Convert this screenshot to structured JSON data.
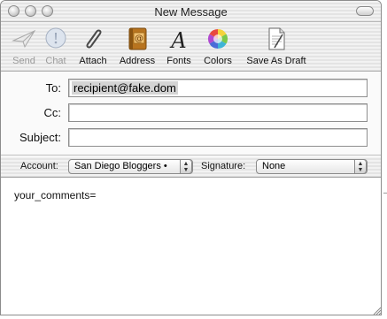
{
  "window": {
    "title": "New Message"
  },
  "toolbar": {
    "items": [
      {
        "label": "Send",
        "icon": "send-icon",
        "enabled": false
      },
      {
        "label": "Chat",
        "icon": "chat-icon",
        "enabled": false
      },
      {
        "label": "Attach",
        "icon": "paperclip-icon",
        "enabled": true
      },
      {
        "label": "Address",
        "icon": "address-book-icon",
        "enabled": true
      },
      {
        "label": "Fonts",
        "icon": "fonts-icon",
        "enabled": true
      },
      {
        "label": "Colors",
        "icon": "color-wheel-icon",
        "enabled": true
      },
      {
        "label": "Save As Draft",
        "icon": "draft-icon",
        "enabled": true
      }
    ]
  },
  "headers": {
    "to_label": "To:",
    "to_value": "recipient@fake.dom",
    "cc_label": "Cc:",
    "cc_value": "",
    "subject_label": "Subject:",
    "subject_value": ""
  },
  "account": {
    "account_label": "Account:",
    "account_value": "San Diego Bloggers •",
    "signature_label": "Signature:",
    "signature_value": "None"
  },
  "message": {
    "body": "your_comments="
  },
  "colors": {
    "chrome": "#e8e8e8",
    "field_border": "#8e8e8e",
    "disabled_text": "#9a9a9a"
  }
}
